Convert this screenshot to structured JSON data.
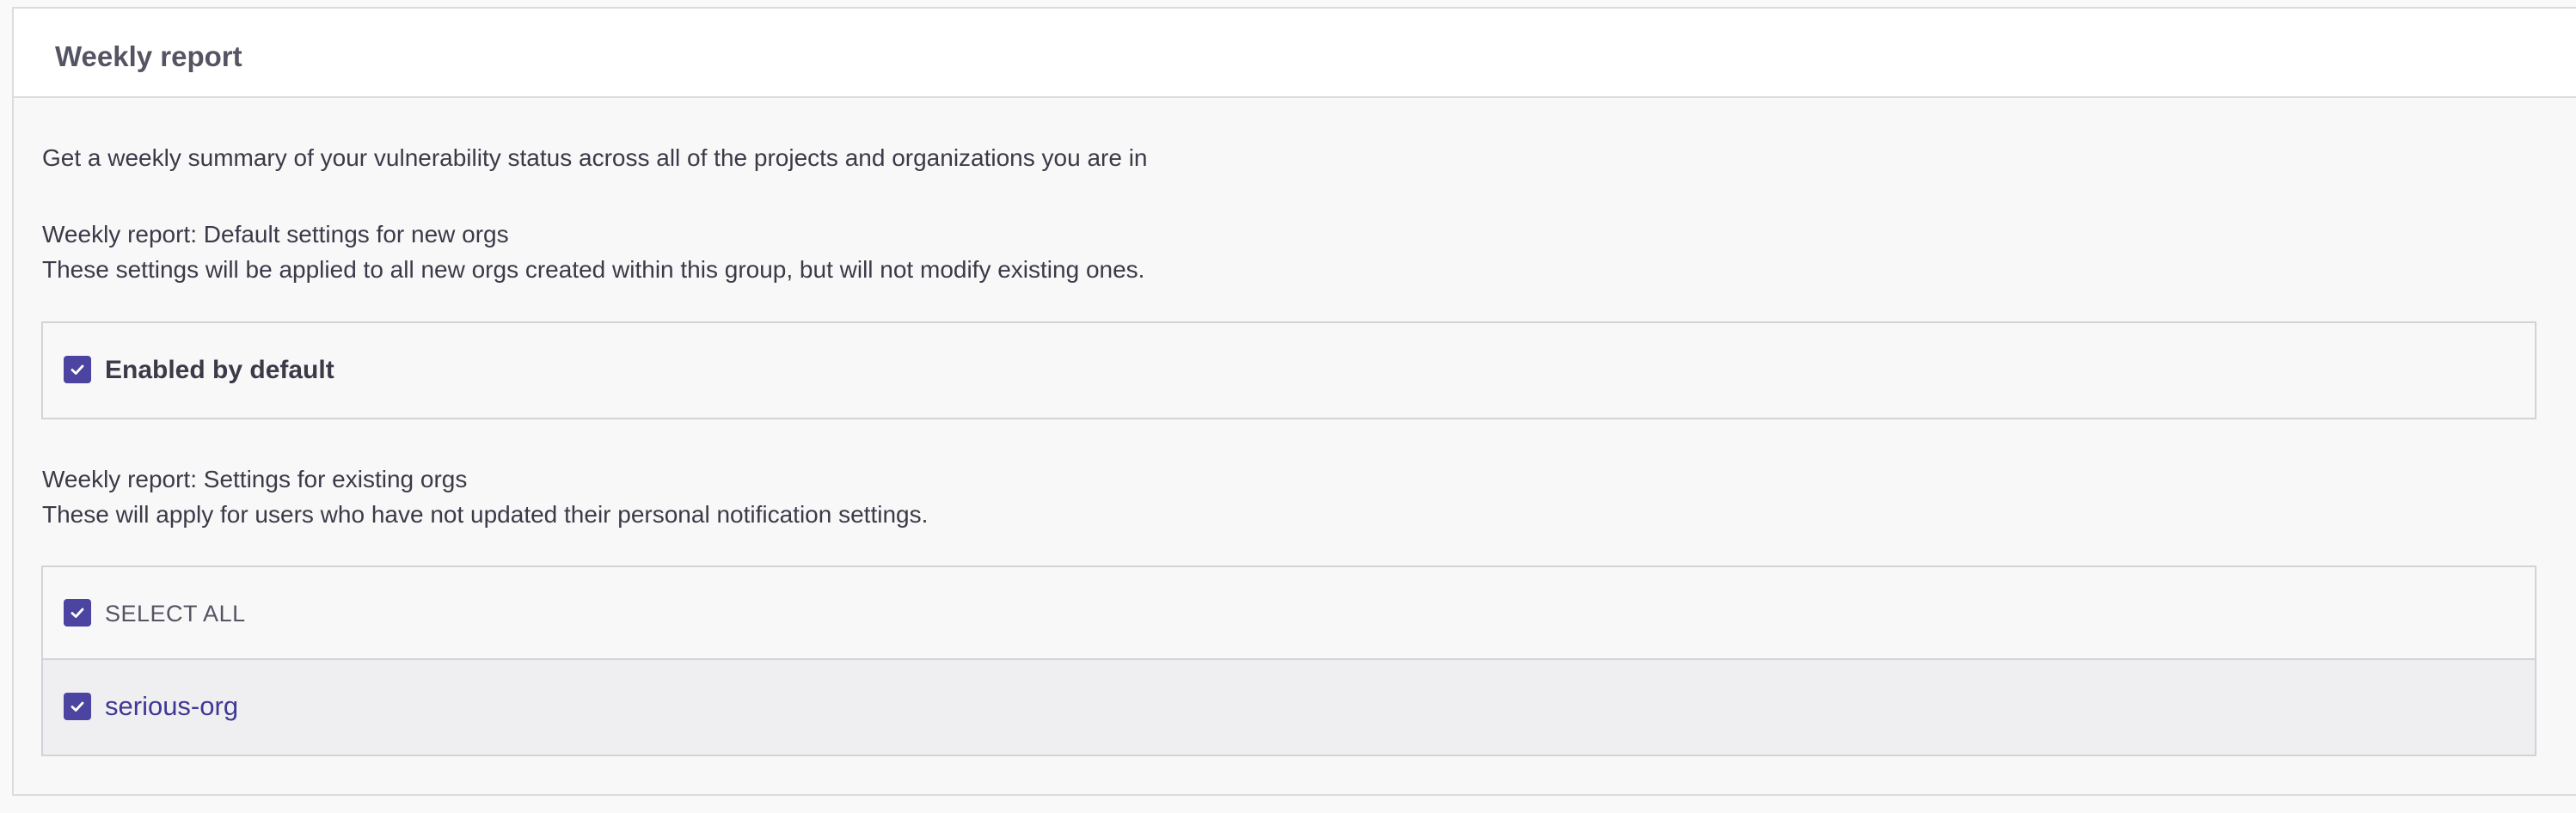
{
  "weekly_report": {
    "title": "Weekly report",
    "description": "Get a weekly summary of your vulnerability status across all of the projects and organizations you are in",
    "defaults": {
      "heading": "Weekly report: Default settings for new orgs",
      "subheading": "These settings will be applied to all new orgs created within this group, but will not modify existing ones.",
      "enabled_label": "Enabled by default",
      "enabled_checked": true
    },
    "existing": {
      "heading": "Weekly report: Settings for existing orgs",
      "subheading": "These will apply for users who have not updated their personal notification settings.",
      "select_all_label": "SELECT ALL",
      "select_all_checked": true,
      "orgs": [
        {
          "name": "serious-org",
          "checked": true
        }
      ]
    }
  },
  "colors": {
    "accent": "#4b45a1",
    "link": "#3f3896",
    "text": "#3b3a48",
    "title": "#555463",
    "border": "#d2d2d8"
  }
}
